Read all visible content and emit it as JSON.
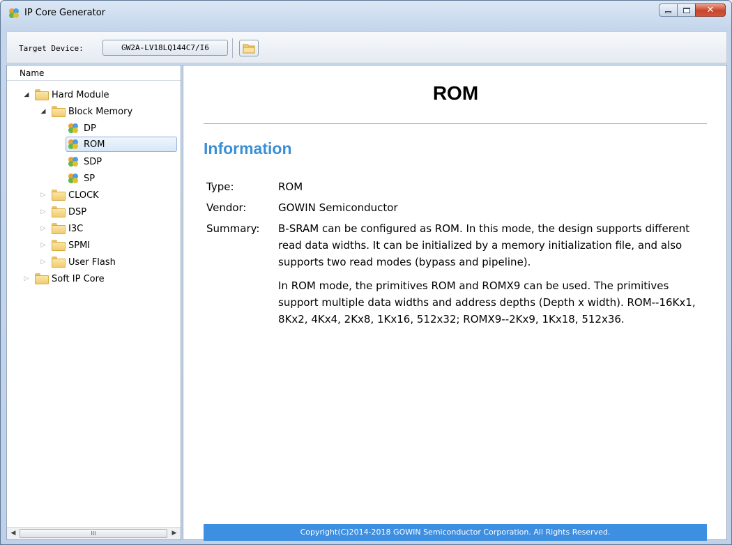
{
  "window": {
    "title": "IP Core Generator",
    "controls": {
      "minimize": "minimize",
      "maximize": "maximize",
      "close": "close"
    }
  },
  "toolbar": {
    "target_label": "Target Device:",
    "device": "GW2A-LV18LQ144C7/I6",
    "open_icon": "folder-open-icon"
  },
  "tree": {
    "header": "Name",
    "items": [
      {
        "label": "Hard Module",
        "arrow": "◢",
        "type": "folder"
      },
      {
        "label": "Block Memory",
        "arrow": "◢",
        "type": "folder"
      },
      {
        "label": "DP",
        "arrow": "",
        "type": "ipcore"
      },
      {
        "label": "ROM",
        "arrow": "",
        "type": "ipcore"
      },
      {
        "label": "SDP",
        "arrow": "",
        "type": "ipcore"
      },
      {
        "label": "SP",
        "arrow": "",
        "type": "ipcore"
      },
      {
        "label": "CLOCK",
        "arrow": "▷",
        "type": "folder"
      },
      {
        "label": "DSP",
        "arrow": "▷",
        "type": "folder"
      },
      {
        "label": "I3C",
        "arrow": "▷",
        "type": "folder"
      },
      {
        "label": "SPMI",
        "arrow": "▷",
        "type": "folder"
      },
      {
        "label": "User Flash",
        "arrow": "▷",
        "type": "folder"
      },
      {
        "label": "Soft IP Core",
        "arrow": "▷",
        "type": "folder"
      }
    ],
    "selected": "ROM",
    "scroll_grip": "III"
  },
  "content": {
    "title": "ROM",
    "section": "Information",
    "type_label": "Type:",
    "type_value": "ROM",
    "vendor_label": "Vendor:",
    "vendor_value": "GOWIN Semiconductor",
    "summary_label": "Summary:",
    "summary_p1": "B-SRAM can be configured as ROM. In this mode, the design supports different read data widths. It can be initialized by a memory initialization file, and also supports two read modes (bypass and pipeline).",
    "summary_p2": "In ROM mode, the primitives ROM and ROMX9 can be used. The primitives support multiple data widths and address depths (Depth x width). ROM--16Kx1, 8Kx2, 4Kx4, 2Kx8, 1Kx16, 512x32; ROMX9--2Kx9, 1Kx18, 512x36.",
    "footer": "Copyright(C)2014-2018 GOWIN Semiconductor Corporation. All Rights Reserved."
  },
  "colors": {
    "accent": "#3a8fd6",
    "footer_bg": "#3d8fe2",
    "selection_border": "#8fb2dc"
  }
}
